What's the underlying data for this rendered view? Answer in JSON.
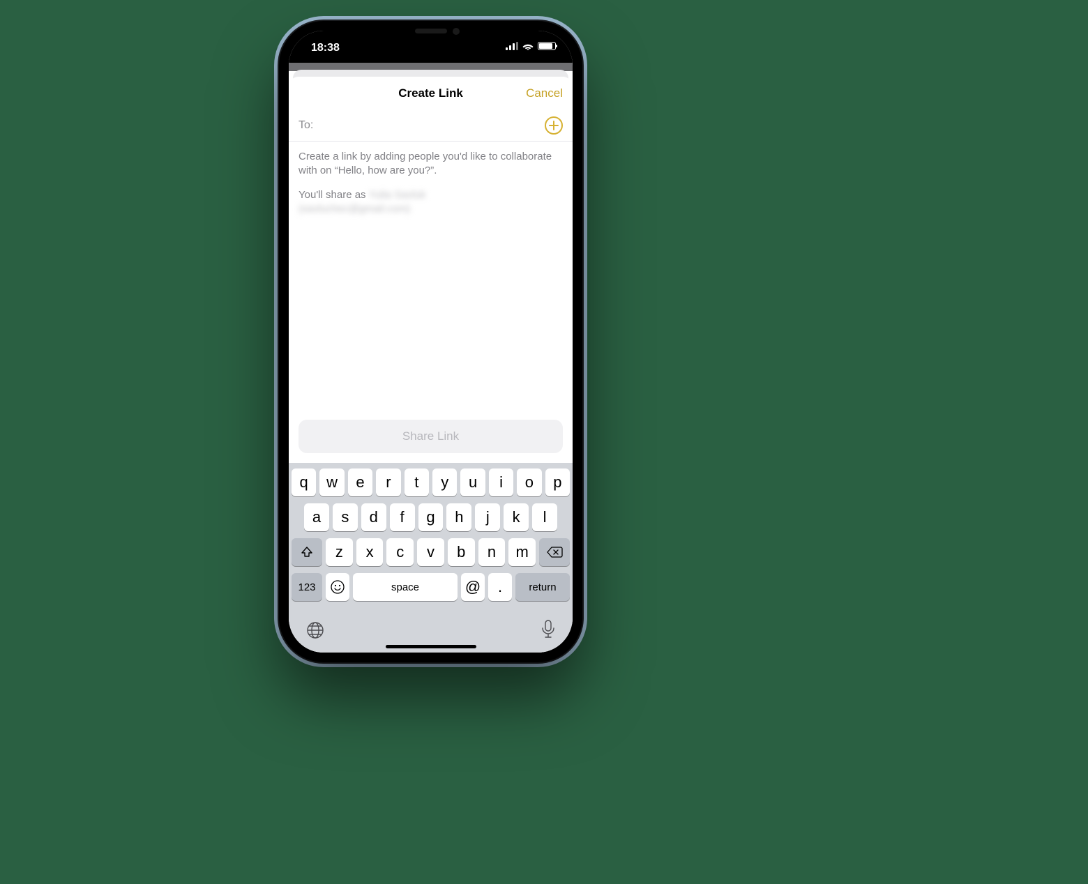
{
  "statusbar": {
    "time": "18:38"
  },
  "nav": {
    "title": "Create Link",
    "cancel": "Cancel"
  },
  "to": {
    "label": "To:"
  },
  "body": {
    "intro": "Create a link by adding people you'd like to collaborate with on “Hello, how are you?”.",
    "share_as_prefix": "You'll share as ",
    "share_as_name": "Yulia Savluk",
    "share_as_email": "(savluchec@gmail.com)"
  },
  "share_button": "Share Link",
  "keyboard": {
    "row1": [
      "q",
      "w",
      "e",
      "r",
      "t",
      "y",
      "u",
      "i",
      "o",
      "p"
    ],
    "row2": [
      "a",
      "s",
      "d",
      "f",
      "g",
      "h",
      "j",
      "k",
      "l"
    ],
    "row3": [
      "z",
      "x",
      "c",
      "v",
      "b",
      "n",
      "m"
    ],
    "num": "123",
    "space": "space",
    "at": "@",
    "dot": ".",
    "return": "return"
  }
}
